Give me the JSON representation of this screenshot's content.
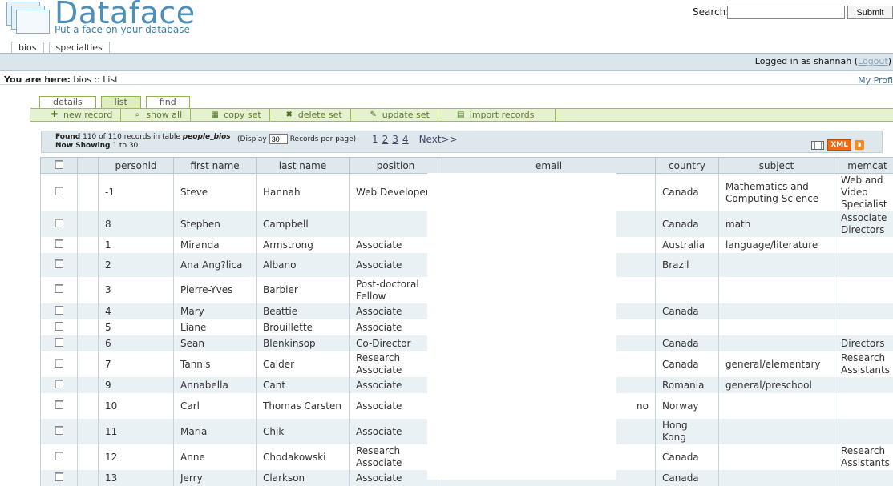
{
  "header": {
    "brand": "Dataface",
    "tagline": "Put a face on your database",
    "search_label": "Search:",
    "search_value": "",
    "search_button": "Submit"
  },
  "top_tabs": [
    {
      "label": "bios",
      "active": true
    },
    {
      "label": "specialties",
      "active": false
    }
  ],
  "login": {
    "prefix": "Logged in as shannah (",
    "logout": "Logout",
    "suffix": ")"
  },
  "breadcrumb": {
    "label": "You are here:",
    "path": "bios :: List"
  },
  "my_profile": "My Profi",
  "action_tabs": [
    {
      "label": "details",
      "active": false
    },
    {
      "label": "list",
      "active": true
    },
    {
      "label": "find",
      "active": false
    }
  ],
  "actions": [
    {
      "label": "new record",
      "icon": "plus-icon"
    },
    {
      "label": "show all",
      "icon": "magnifier-icon"
    },
    {
      "label": "copy set",
      "icon": "table-icon"
    },
    {
      "label": "delete set",
      "icon": "delete-icon"
    },
    {
      "label": "update set",
      "icon": "pencil-icon"
    },
    {
      "label": "import records",
      "icon": "import-icon"
    }
  ],
  "results": {
    "found_prefix": "Found",
    "found_text": " 110 of 110 records in table ",
    "table_name": "people_bios",
    "showing_label": "Now Showing",
    "showing_range": " 1 to 30",
    "display_prefix": "(Display",
    "display_value": "30",
    "display_suffix": "Records per page)",
    "current_page": "1",
    "pages": [
      "2",
      "3",
      "4"
    ],
    "next": "Next>>"
  },
  "exports": {
    "xml": "XML"
  },
  "columns": [
    "",
    "",
    "personid",
    "first name",
    "last name",
    "position",
    "email",
    "country",
    "subject",
    "memcat"
  ],
  "rows": [
    {
      "id": "-1",
      "first": "Steve",
      "last": "Hannah",
      "position": "Web Developer",
      "email": "",
      "country": "Canada",
      "subject": "Mathematics and Computing Science",
      "memcat": "Web and Video Specialist"
    },
    {
      "id": "8",
      "first": "Stephen",
      "last": "Campbell",
      "position": "",
      "email": "",
      "country": "Canada",
      "subject": "math",
      "memcat": "Associate Directors"
    },
    {
      "id": "1",
      "first": "Miranda",
      "last": "Armstrong",
      "position": "Associate",
      "email": "",
      "country": "Australia",
      "subject": "language/literature",
      "memcat": ""
    },
    {
      "id": "2",
      "first": "Ana Ang?lica",
      "last": "Albano",
      "position": "Associate",
      "email": "",
      "country": "Brazil",
      "subject": "",
      "memcat": ""
    },
    {
      "id": "3",
      "first": "Pierre-Yves",
      "last": "Barbier",
      "position": "Post-doctoral Fellow",
      "email": "",
      "country": "",
      "subject": "",
      "memcat": ""
    },
    {
      "id": "4",
      "first": "Mary",
      "last": "Beattie",
      "position": "Associate",
      "email": "",
      "country": "Canada",
      "subject": "",
      "memcat": ""
    },
    {
      "id": "5",
      "first": "Liane",
      "last": "Brouillette",
      "position": "Associate",
      "email": "",
      "country": "",
      "subject": "",
      "memcat": ""
    },
    {
      "id": "6",
      "first": "Sean",
      "last": "Blenkinsop",
      "position": "Co-Director",
      "email": "",
      "country": "Canada",
      "subject": "",
      "memcat": "Directors"
    },
    {
      "id": "7",
      "first": "Tannis",
      "last": "Calder",
      "position": "Research Associate",
      "email": "",
      "country": "Canada",
      "subject": "general/elementary",
      "memcat": "Research Assistants"
    },
    {
      "id": "9",
      "first": "Annabella",
      "last": "Cant",
      "position": "Associate",
      "email": "",
      "country": "Romania",
      "subject": "general/preschool",
      "memcat": ""
    },
    {
      "id": "10",
      "first": "Carl",
      "last": "Thomas Carsten",
      "position": "Associate",
      "email": "no",
      "country": "Norway",
      "subject": "",
      "memcat": ""
    },
    {
      "id": "11",
      "first": "Maria",
      "last": "Chik",
      "position": "Associate",
      "email": "",
      "country": "Hong Kong",
      "subject": "",
      "memcat": ""
    },
    {
      "id": "12",
      "first": "Anne",
      "last": "Chodakowski",
      "position": "Research Associate",
      "email": "",
      "country": "Canada",
      "subject": "",
      "memcat": "Research Assistants"
    },
    {
      "id": "13",
      "first": "Jerry",
      "last": "Clarkson",
      "position": "Associate",
      "email": "",
      "country": "Canada",
      "subject": "",
      "memcat": ""
    }
  ]
}
